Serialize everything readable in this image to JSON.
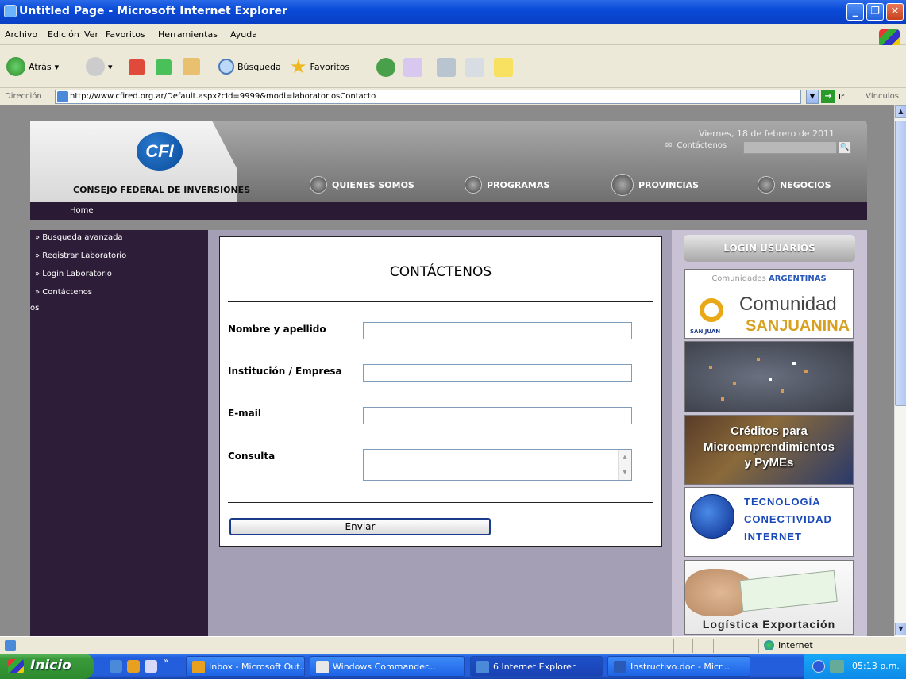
{
  "window": {
    "title": "Untitled Page - Microsoft Internet Explorer"
  },
  "menu": [
    "Archivo",
    "Edición",
    "Ver",
    "Favoritos",
    "Herramientas",
    "Ayuda"
  ],
  "toolbar": {
    "back": "Atrás",
    "search": "Búsqueda",
    "favorites": "Favoritos"
  },
  "address": {
    "label": "Dirección",
    "url": "http://www.cfired.org.ar/Default.aspx?cId=9999&modl=laboratoriosContacto",
    "go": "Ir",
    "links": "Vínculos"
  },
  "site": {
    "logo": "CFI",
    "org_name": "CONSEJO FEDERAL DE INVERSIONES",
    "date": "Viernes, 18 de febrero de 2011",
    "contact_link": "Contáctenos",
    "nav": [
      "QUIENES SOMOS",
      "PROGRAMAS",
      "PROVINCIAS",
      "NEGOCIOS"
    ],
    "breadcrumb": "Home"
  },
  "sidebar": {
    "items": [
      "» Busqueda avanzada",
      "» Registrar Laboratorio",
      "» Login Laboratorio",
      "» Contáctenos"
    ],
    "fragment": "os"
  },
  "form": {
    "title": "CONTÁCTENOS",
    "labels": {
      "name": "Nombre y apellido",
      "company": "Institución / Empresa",
      "email": "E-mail",
      "query": "Consulta"
    },
    "submit": "Enviar"
  },
  "right": {
    "login": "LOGIN USUARIOS",
    "banner1": {
      "top_a": "Comunidades ",
      "top_b": "ARGENTINAS",
      "line1": "Comunidad",
      "line2": "SANJUANINA",
      "small": "SAN JUAN"
    },
    "banner3": {
      "l1": "Créditos para",
      "l2": "Microemprendimientos",
      "l3": "y PyMEs"
    },
    "banner4": {
      "l1": "TECNOLOGÍA",
      "l2": "CONECTIVIDAD",
      "l3": "INTERNET"
    },
    "banner5": "Logística Exportación"
  },
  "status": {
    "zone": "Internet"
  },
  "taskbar": {
    "start": "Inicio",
    "tasks": [
      "Inbox - Microsoft Out...",
      "Windows Commander...",
      "6 Internet Explorer",
      "Instructivo.doc - Micr..."
    ],
    "clock": "05:13 p.m."
  }
}
